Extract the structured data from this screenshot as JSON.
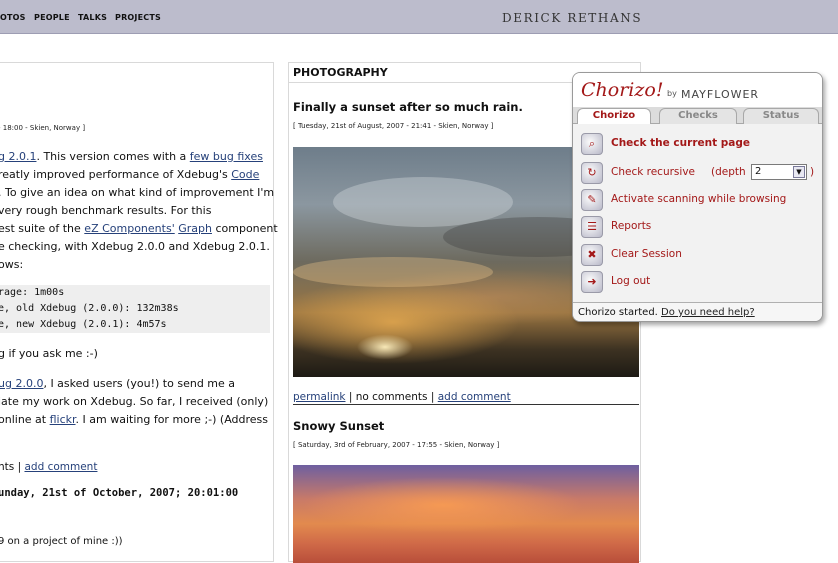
{
  "nav": {
    "items": [
      "PHOTOS",
      "PEOPLE",
      "TALKS",
      "PROJECTS"
    ],
    "visible_first": "OTOS"
  },
  "site": {
    "title": "DERICK RETHANS"
  },
  "left_column": {
    "dateline": "- 18:00 - Skien, Norway ]",
    "lines": [
      {
        "pre": "",
        "link": "g 2.0.1",
        "post": ". This version comes with a ",
        "link2": "few bug fixes"
      },
      {
        "pre": "reatly improved performance of Xdebug's ",
        "link": "Code"
      },
      {
        "pre": ". To give an idea on what kind of improvement I'm"
      },
      {
        "pre": "very rough benchmark results. For this"
      },
      {
        "pre": "est suite of the ",
        "link": "eZ Components'",
        "mid": " ",
        "link2": "Graph",
        "post": " component"
      },
      {
        "pre": "e checking, with Xdebug 2.0.0 and Xdebug 2.0.1."
      },
      {
        "pre": "ows:"
      }
    ],
    "code": [
      "rage: 1m00s",
      "e, old Xdebug (2.0.0): 132m38s",
      "e, new Xdebug (2.0.1): 4m57s"
    ],
    "after_code": "g if you ask me :-)",
    "para2": [
      {
        "link": "ug 2.0.0",
        "post": ", I asked users (you!) to send me a"
      },
      {
        "pre": "iate my work on Xdebug. So far, I received (only)"
      },
      {
        "pre": "online at ",
        "link": "flickr",
        "post": ". I am waiting for more ;-) (Address"
      }
    ],
    "actions": {
      "comments": "nts",
      "separator": " | ",
      "add_comment": "add comment"
    },
    "next_date": "unday, 21st of October, 2007; 20:01:00",
    "last_line": "9 on a project of mine :))"
  },
  "middle_column": {
    "heading": "PHOTOGRAPHY",
    "posts": [
      {
        "title": "Finally a sunset after so much rain.",
        "meta": "[ Tuesday, 21st of August, 2007 - 21:41 - Skien, Norway ]",
        "permalink": "permalink",
        "comments": "no comments",
        "add_comment": "add comment"
      },
      {
        "title": "Snowy Sunset",
        "meta": "[ Saturday, 3rd of February, 2007 - 17:55 - Skien, Norway ]"
      }
    ],
    "separator": " | "
  },
  "chorizo": {
    "logo": "Chorizo!",
    "by": "by",
    "brand": "MAYFLOWER",
    "tabs": [
      "Chorizo",
      "Checks",
      "Status"
    ],
    "items": [
      {
        "label": "Check the current page",
        "icon": "magnifier-icon"
      },
      {
        "label": "Check recursive",
        "icon": "refresh-icon"
      },
      {
        "label": "Activate scanning while browsing",
        "icon": "scan-icon"
      },
      {
        "label": "Reports",
        "icon": "report-icon"
      },
      {
        "label": "Clear Session",
        "icon": "clear-icon"
      },
      {
        "label": "Log out",
        "icon": "logout-icon"
      }
    ],
    "depth_label": "(depth",
    "depth_value": "2",
    "depth_close": ")",
    "status_text": "Chorizo started.",
    "help_link": "Do you need help?"
  }
}
